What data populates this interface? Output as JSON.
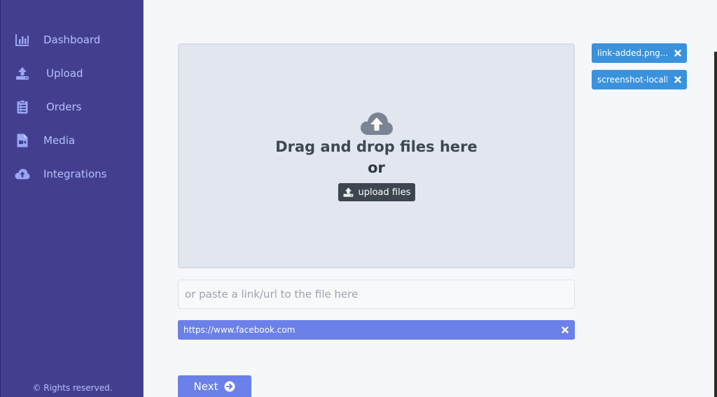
{
  "sidebar": {
    "items": [
      {
        "label": "Dashboard",
        "icon": "chart-icon"
      },
      {
        "label": "Upload",
        "icon": "upload-icon"
      },
      {
        "label": "Orders",
        "icon": "clipboard-icon"
      },
      {
        "label": "Media",
        "icon": "video-file-icon"
      },
      {
        "label": "Integrations",
        "icon": "cloud-upload-icon"
      }
    ],
    "footer": "© Rights reserved."
  },
  "dropzone": {
    "title": "Drag and drop files here",
    "or": "or",
    "upload_label": "upload files"
  },
  "url_input": {
    "placeholder": "or paste a link/url to the file here",
    "value": ""
  },
  "added_link": "https://www.facebook.com",
  "next_label": "Next",
  "files": [
    {
      "name": "link-added.png..."
    },
    {
      "name": "screenshot-localh..."
    }
  ],
  "colors": {
    "sidebar": "#433f8e",
    "accent": "#6b80e8",
    "file_chip": "#3a92dc"
  }
}
